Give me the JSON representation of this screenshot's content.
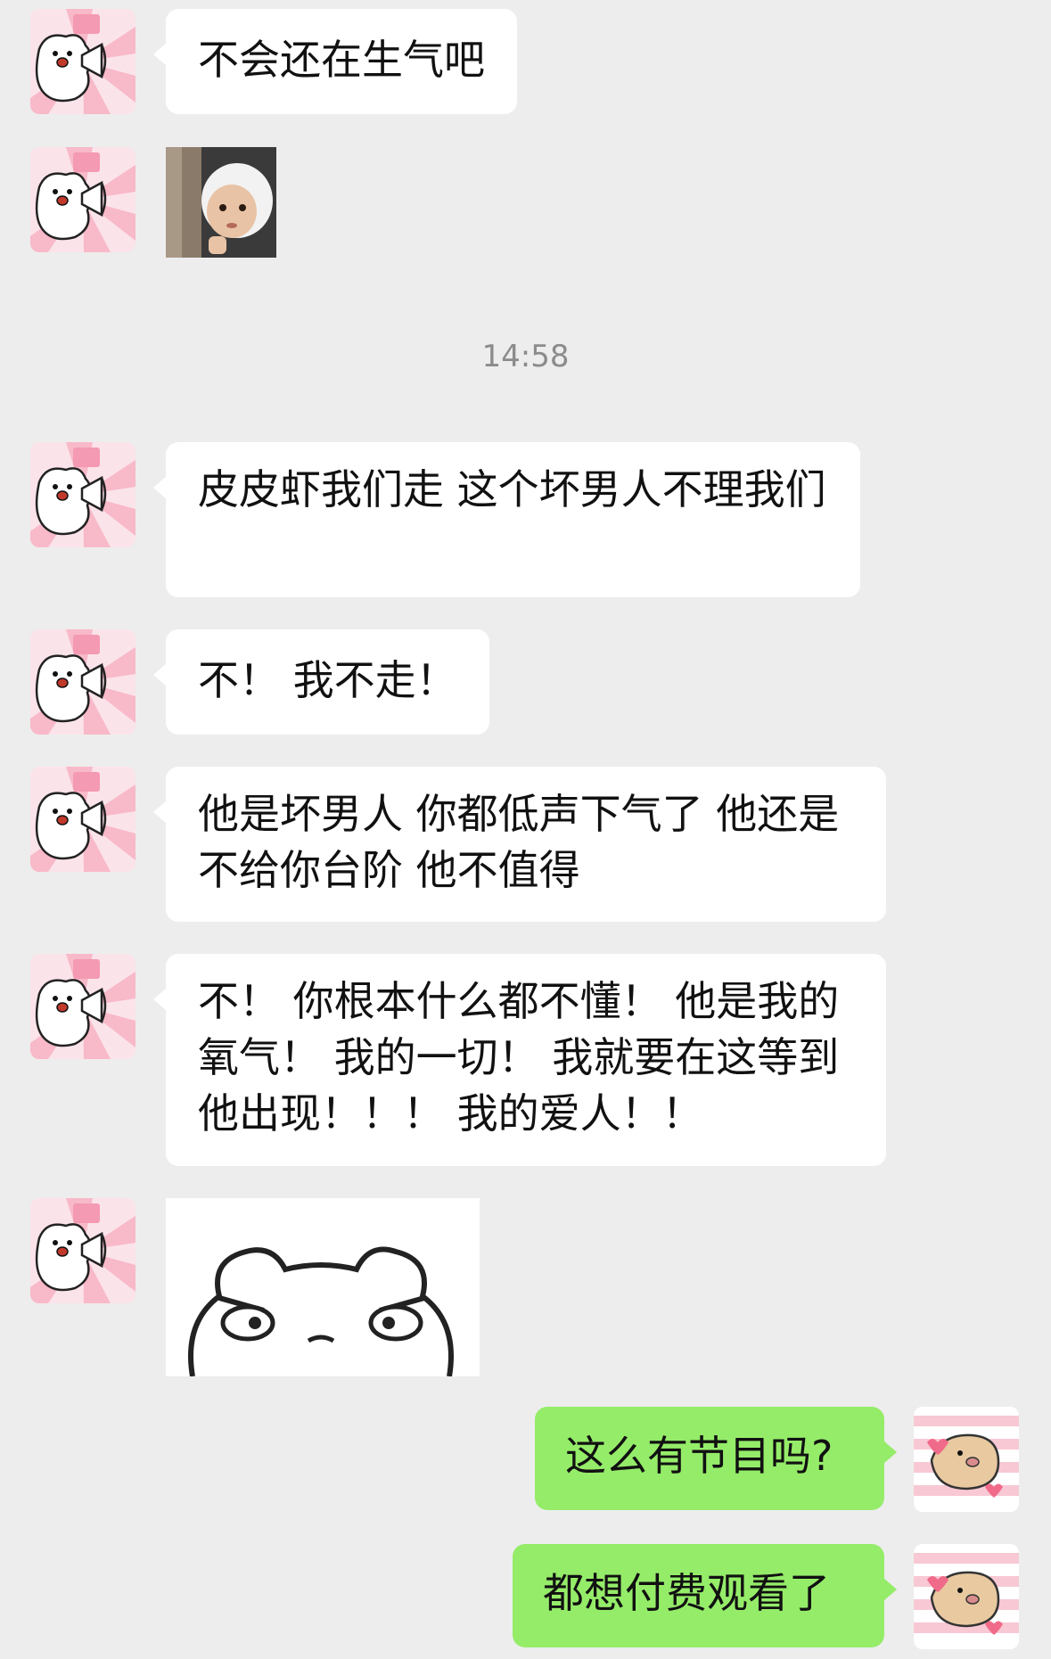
{
  "chat": {
    "messages_before": [
      {
        "text": "不会还在生气吧"
      }
    ],
    "timestamp": "14:58",
    "messages_after": [
      {
        "text": "皮皮虾我们走 这个坏男人不理我们"
      },
      {
        "text": "不！ 我不走！"
      },
      {
        "text": "他是坏男人 你都低声下气了 他还是不给你台阶 他不值得"
      },
      {
        "text": "不！ 你根本什么都不懂！ 他是我的氧气！ 我的一切！ 我就要在这等到他出现！！！ 我的爱人！！"
      }
    ],
    "messages_self": [
      {
        "text": "这么有节目吗?"
      },
      {
        "text": "都想付费观看了"
      }
    ]
  },
  "colors": {
    "background": "#ededed",
    "bubble_left": "#ffffff",
    "bubble_right": "#95ec69",
    "timestamp_text": "#8b8b8b"
  },
  "icons": {
    "left_avatar": "bear-megaphone-avatar-icon",
    "right_avatar": "pig-hearts-avatar-icon"
  }
}
